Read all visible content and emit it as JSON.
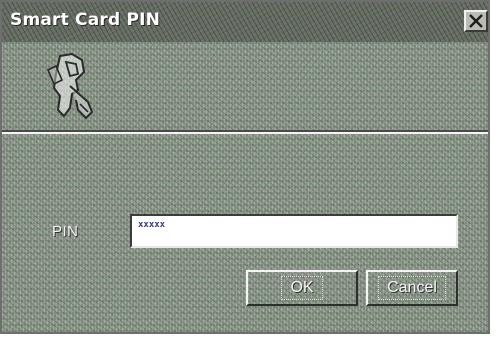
{
  "window": {
    "title": "Smart Card PIN",
    "close_icon": "close-icon"
  },
  "header": {
    "icon": "smart-card-key-icon"
  },
  "form": {
    "pin_label": "PIN",
    "pin_value": "xxxxx"
  },
  "buttons": {
    "ok_label": "OK",
    "cancel_label": "Cancel"
  },
  "colors": {
    "background": "#8f9a8c",
    "text": "#f4f4f4"
  }
}
